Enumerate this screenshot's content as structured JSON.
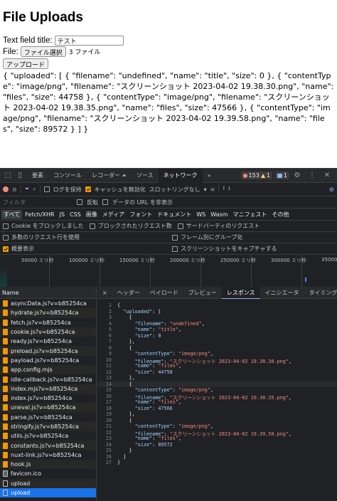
{
  "page": {
    "title": "File Uploads",
    "text_field_label": "Text field title:",
    "text_field_value": "テスト",
    "file_label": "File:",
    "file_button": "ファイル選択",
    "file_count": "3 ファイル",
    "upload_button": "アップロード",
    "result": "{ \"uploaded\": [ { \"filename\": \"undefined\", \"name\": \"title\", \"size\": 0 }, { \"contentType\": \"image/png\", \"filename\": \"スクリーンショット 2023-04-02 19.38.30.png\", \"name\": \"files\", \"size\": 44758 }, { \"contentType\": \"image/png\", \"filename\": \"スクリーンショット 2023-04-02 19.38.35.png\", \"name\": \"files\", \"size\": 47566 }, { \"contentType\": \"image/png\", \"filename\": \"スクリーンショット 2023-04-02 19.39.58.png\", \"name\": \"files\", \"size\": 89572 } ] }"
  },
  "devtools": {
    "tabs": [
      "要素",
      "コンソール",
      "レコーダー ⏶",
      "ソース",
      "ネットワーク"
    ],
    "more": "»",
    "errors": "153",
    "warnings": "1",
    "messages": "1",
    "toolbar": {
      "preserve_log": "ログを保持",
      "disable_cache": "キャッシュを無効化",
      "throttle": "スロットリングなし"
    },
    "filter": {
      "placeholder": "フィルタ",
      "invert": "反転",
      "hide_data_urls": "データの URL を非表示"
    },
    "types": [
      "すべて",
      "Fetch/XHR",
      "JS",
      "CSS",
      "画像",
      "メディア",
      "フォント",
      "ドキュメント",
      "WS",
      "Wasm",
      "マニフェスト",
      "その他"
    ],
    "options": {
      "blocked_cookies": "Cookie をブロックしました",
      "blocked_requests": "ブロックされたリクエスト数",
      "third_party": "サードパーティのリクエスト",
      "big_rows": "多数のリクエスト行を使用",
      "group_by_frame": "フレーム別にグループ化",
      "overview": "概要表示",
      "screenshots": "スクリーンショットをキャプチャする"
    },
    "overview_labels": [
      "50000 ミリ秒",
      "100000 ミリ秒",
      "150000 ミリ秒",
      "200000 ミリ秒",
      "250000 ミリ秒",
      "300000 ミリ秒",
      "35000"
    ],
    "name_header": "Name",
    "requests": [
      {
        "name": "asyncData.js?v=b85254ca",
        "type": "js"
      },
      {
        "name": "hydrate.js?v=b85254ca",
        "type": "js"
      },
      {
        "name": "fetch.js?v=b85254ca",
        "type": "js"
      },
      {
        "name": "cookie.js?v=b85254ca",
        "type": "js"
      },
      {
        "name": "ready.js?v=b85254ca",
        "type": "js"
      },
      {
        "name": "preload.js?v=b85254ca",
        "type": "js"
      },
      {
        "name": "payload.js?v=b85254ca",
        "type": "js"
      },
      {
        "name": "app.config.mjs",
        "type": "js"
      },
      {
        "name": "idle-callback.js?v=b85254ca",
        "type": "js"
      },
      {
        "name": "index.mjs?v=b85254ca",
        "type": "js"
      },
      {
        "name": "index.js?v=b85254ca",
        "type": "js"
      },
      {
        "name": "uneval.js?v=b85254ca",
        "type": "js"
      },
      {
        "name": "parse.js?v=b85254ca",
        "type": "js"
      },
      {
        "name": "stringify.js?v=b85254ca",
        "type": "js"
      },
      {
        "name": "utils.js?v=b85254ca",
        "type": "js"
      },
      {
        "name": "constants.js?v=b85254ca",
        "type": "js"
      },
      {
        "name": "nuxt-link.js?v=b85254ca",
        "type": "js"
      },
      {
        "name": "hook.js",
        "type": "js"
      },
      {
        "name": "favicon.ico",
        "type": "img"
      },
      {
        "name": "upload",
        "type": "doc"
      },
      {
        "name": "upload",
        "type": "doc",
        "selected": true
      }
    ],
    "detail_tabs": [
      "ヘッダー",
      "ペイロード",
      "プレビュー",
      "レスポンス",
      "イニシエータ",
      "タイミング"
    ],
    "active_detail_tab": "レスポンス",
    "close": "×",
    "response_lines": [
      "{",
      "  \"uploaded\": [",
      "    {",
      "      \"filename\": \"undefined\",",
      "      \"name\": \"title\",",
      "      \"size\": 0",
      "    },",
      "    {",
      "      \"contentType\": \"image/png\",",
      "      \"filename\": \"スクリーンショット 2023-04-02 19.38.30.png\",",
      "      \"name\": \"files\",",
      "      \"size\": 44758",
      "    },",
      "    {",
      "      \"contentType\": \"image/png\",",
      "      \"filename\": \"スクリーンショット 2023-04-02 19.38.35.png\",",
      "      \"name\": \"files\",",
      "      \"size\": 47566",
      "    },",
      "    {",
      "      \"contentType\": \"image/png\",",
      "      \"filename\": \"スクリーンショット 2023-04-02 19.39.58.png\",",
      "      \"name\": \"files\",",
      "      \"size\": 89572",
      "    }",
      "  ]",
      "}"
    ]
  }
}
